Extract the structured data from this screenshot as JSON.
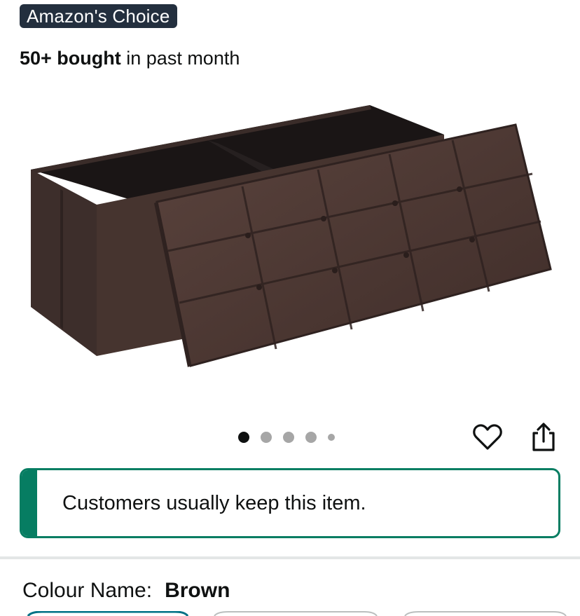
{
  "badge": {
    "label": "Amazon's Choice"
  },
  "purchase_info": {
    "count": "50+ bought",
    "suffix": " in past month"
  },
  "image_carousel": {
    "total_images": 5,
    "active_index": 0
  },
  "actions": {
    "wishlist_icon": "heart-icon",
    "share_icon": "share-icon"
  },
  "keep_notice": {
    "text": "Customers usually keep this item."
  },
  "colour": {
    "label": "Colour Name:",
    "value": "Brown"
  },
  "colors": {
    "badge_bg": "#232f3e",
    "keep_accent": "#067d62",
    "product_fabric": "#4a3530"
  }
}
